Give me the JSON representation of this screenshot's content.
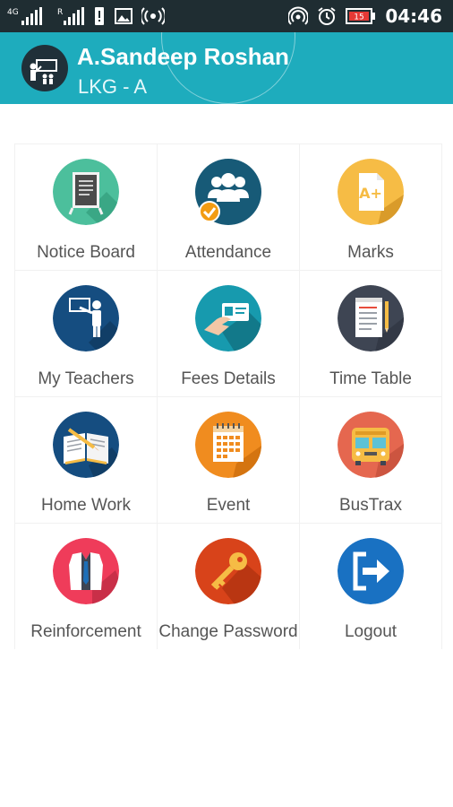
{
  "status_bar": {
    "network": "4G",
    "roaming": "R",
    "battery": "15",
    "time": "04:46"
  },
  "header": {
    "name": "A.Sandeep Roshan",
    "class": "LKG - A",
    "color": "#1eacbd"
  },
  "menu": [
    {
      "label": "Notice Board",
      "icon": "notice-board-icon",
      "color": "#4cbf9c"
    },
    {
      "label": "Attendance",
      "icon": "attendance-icon",
      "color": "#175a77"
    },
    {
      "label": "Marks",
      "icon": "marks-icon",
      "color": "#f6bc45"
    },
    {
      "label": "My Teachers",
      "icon": "teacher-icon",
      "color": "#154d80"
    },
    {
      "label": "Fees Details",
      "icon": "fees-card-icon",
      "color": "#179aae"
    },
    {
      "label": "Time Table",
      "icon": "time-table-icon",
      "color": "#3e4553"
    },
    {
      "label": "Home Work",
      "icon": "homework-book-icon",
      "color": "#154d80"
    },
    {
      "label": "Event",
      "icon": "event-calendar-icon",
      "color": "#f08c1f"
    },
    {
      "label": "BusTrax",
      "icon": "bus-icon",
      "color": "#e5674f"
    },
    {
      "label": "Reinforcement",
      "icon": "reinforcement-vest-icon",
      "color": "#ef3c5a"
    },
    {
      "label": "Change Password",
      "icon": "key-icon",
      "color": "#d8431a"
    },
    {
      "label": "Logout",
      "icon": "logout-icon",
      "color": "#1971c2"
    }
  ]
}
